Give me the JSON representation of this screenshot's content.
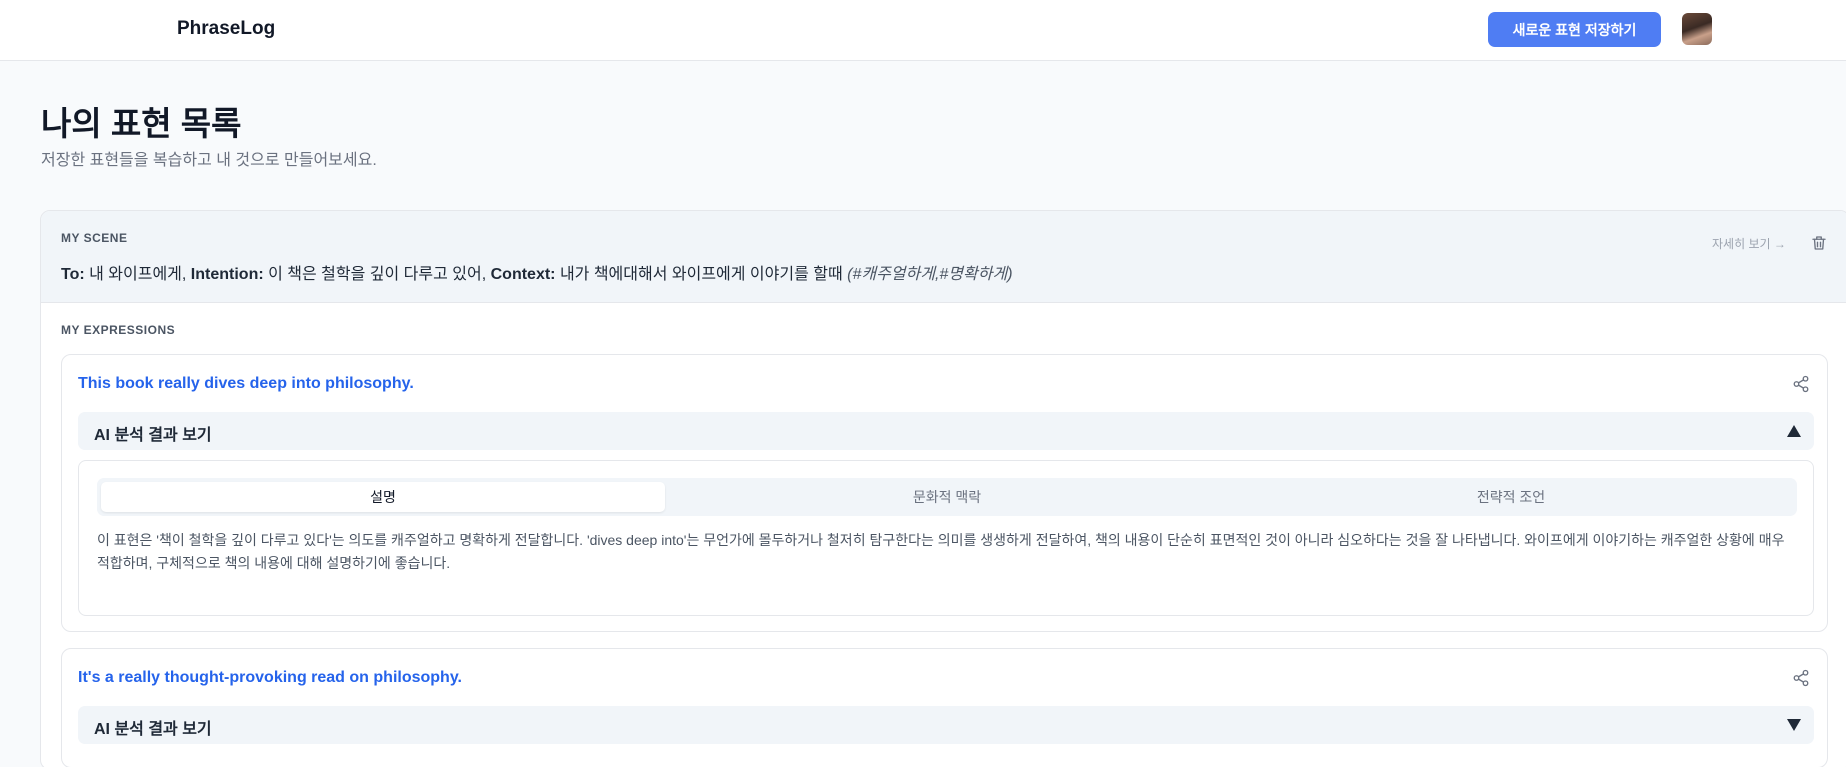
{
  "app": {
    "logo": "PhraseLog",
    "save_button": "새로운 표현 저장하기"
  },
  "header": {
    "title": "나의 표현 목록",
    "subtitle": "저장한 표현들을 복습하고 내 것으로 만들어보세요."
  },
  "scene": {
    "label": "MY SCENE",
    "to_label": "To:",
    "to_value": " 내 와이프에게, ",
    "intention_label": "Intention:",
    "intention_value": " 이 책은 철학을 깊이 다루고 있어, ",
    "context_label": "Context:",
    "context_value": " 내가 책에대해서 와이프에게 이야기를 할때 ",
    "tags": "(#캐주얼하게,#명확하게)",
    "detail_link": "자세히 보기 →"
  },
  "expressions_label": "MY EXPRESSIONS",
  "expressions": [
    {
      "text": "This book really dives deep into philosophy.",
      "ai_label": "AI 분석 결과 보기",
      "expanded": true,
      "tabs": [
        "설명",
        "문화적 맥락",
        "전략적 조언"
      ],
      "active_tab": "설명",
      "description": "이 표현은 '책이 철학을 깊이 다루고 있다'는 의도를 캐주얼하고 명확하게 전달합니다. 'dives deep into'는 무언가에 몰두하거나 철저히 탐구한다는 의미를 생생하게 전달하여, 책의 내용이 단순히 표면적인 것이 아니라 심오하다는 것을 잘 나타냅니다. 와이프에게 이야기하는 캐주얼한 상황에 매우 적합하며, 구체적으로 책의 내용에 대해 설명하기에 좋습니다."
    },
    {
      "text": "It's a really thought-provoking read on philosophy.",
      "ai_label": "AI 분석 결과 보기",
      "expanded": false
    }
  ],
  "colors": {
    "accent": "#4f7df3",
    "expression_text": "#2563eb"
  },
  "icons": [
    "avatar",
    "trash-icon",
    "share-icon",
    "chevron-up-icon",
    "chevron-down-icon"
  ]
}
